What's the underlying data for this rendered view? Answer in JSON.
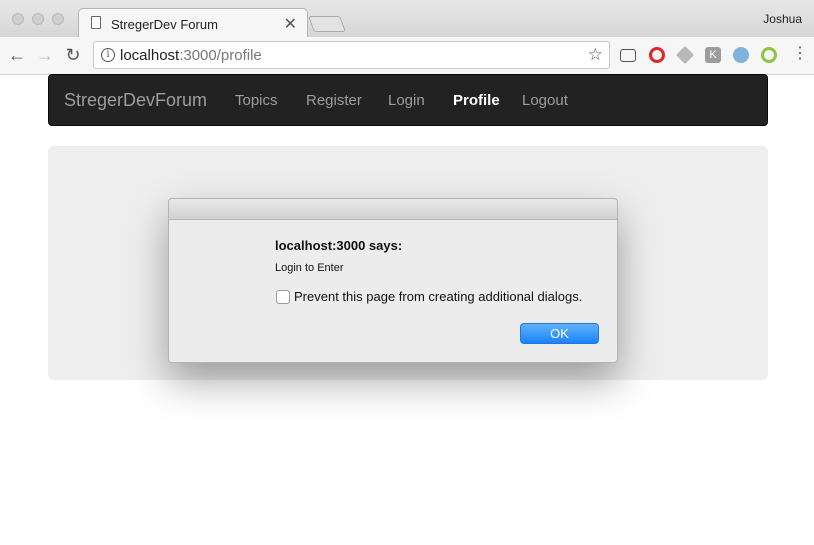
{
  "browser": {
    "tab_title": "StregerDev Forum",
    "tab_close": "✕",
    "profile_name": "Joshua",
    "url_host": "localhost",
    "url_path": ":3000/profile"
  },
  "navbar": {
    "brand": "StregerDevForum",
    "links": [
      "Topics",
      "Register",
      "Login",
      "Profile",
      "Logout"
    ],
    "active": "Profile"
  },
  "dialog": {
    "heading": "localhost:3000 says:",
    "message": "Login to Enter",
    "checkbox_label": "Prevent this page from creating additional dialogs.",
    "ok_label": "OK"
  }
}
